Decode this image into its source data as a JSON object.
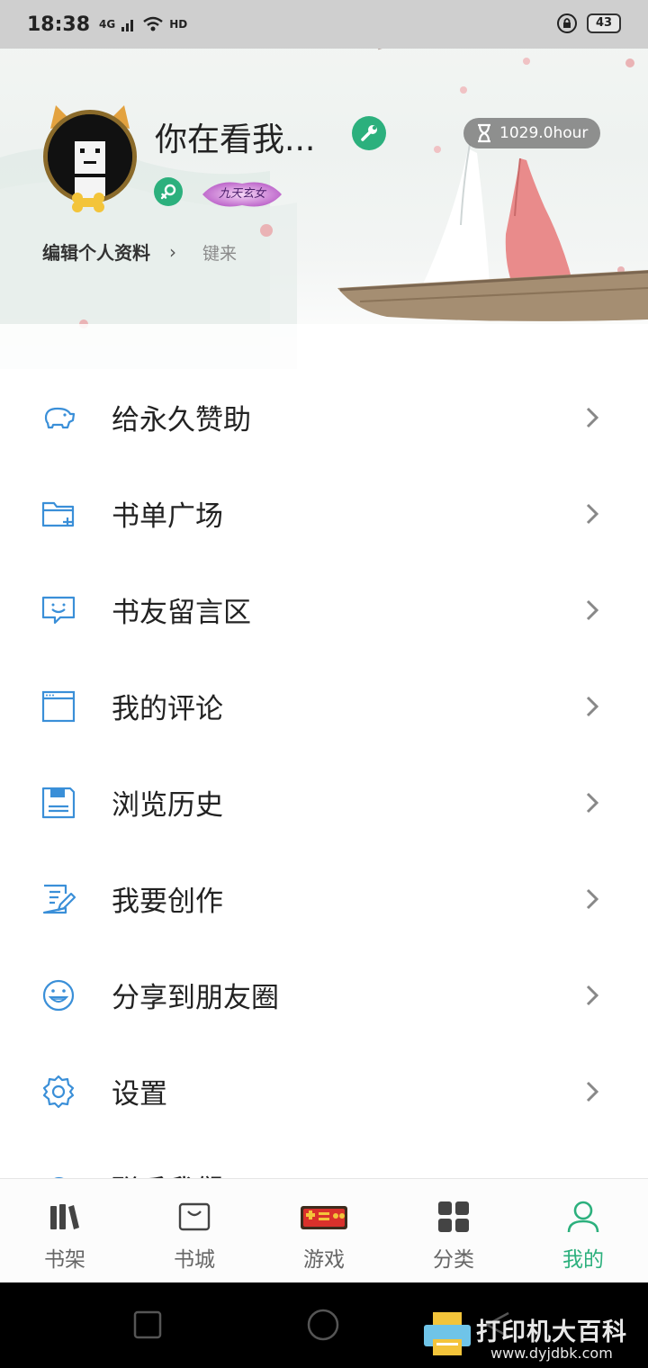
{
  "status_bar": {
    "time": "18:38",
    "network": "4G",
    "hd": "HD",
    "battery": "43"
  },
  "profile": {
    "username": "你在看我...",
    "hours": "1029.0hour",
    "title_badge": "九天玄女",
    "edit_profile": "编辑个人资料",
    "signature": "键来"
  },
  "menu": {
    "items": [
      {
        "label": "给永久赞助",
        "icon": "piggy-bank-icon"
      },
      {
        "label": "书单广场",
        "icon": "folder-add-icon"
      },
      {
        "label": "书友留言区",
        "icon": "message-icon"
      },
      {
        "label": "我的评论",
        "icon": "window-icon"
      },
      {
        "label": "浏览历史",
        "icon": "save-icon"
      },
      {
        "label": "我要创作",
        "icon": "write-icon"
      },
      {
        "label": "分享到朋友圈",
        "icon": "smile-icon"
      },
      {
        "label": "设置",
        "icon": "gear-icon"
      },
      {
        "label": "联系我们",
        "icon": "contact-icon"
      }
    ]
  },
  "bottom_nav": {
    "items": [
      {
        "label": "书架",
        "icon": "bookshelf-icon"
      },
      {
        "label": "书城",
        "icon": "bag-icon"
      },
      {
        "label": "游戏",
        "icon": "game-icon"
      },
      {
        "label": "分类",
        "icon": "grid-icon"
      },
      {
        "label": "我的",
        "icon": "person-icon"
      }
    ],
    "active": "我的"
  },
  "watermark": {
    "text": "打印机大百科",
    "url": "www.dyjdbk.com"
  },
  "colors": {
    "accent": "#2cb07d",
    "icon_blue": "#3a8fd8",
    "text": "#222222"
  }
}
